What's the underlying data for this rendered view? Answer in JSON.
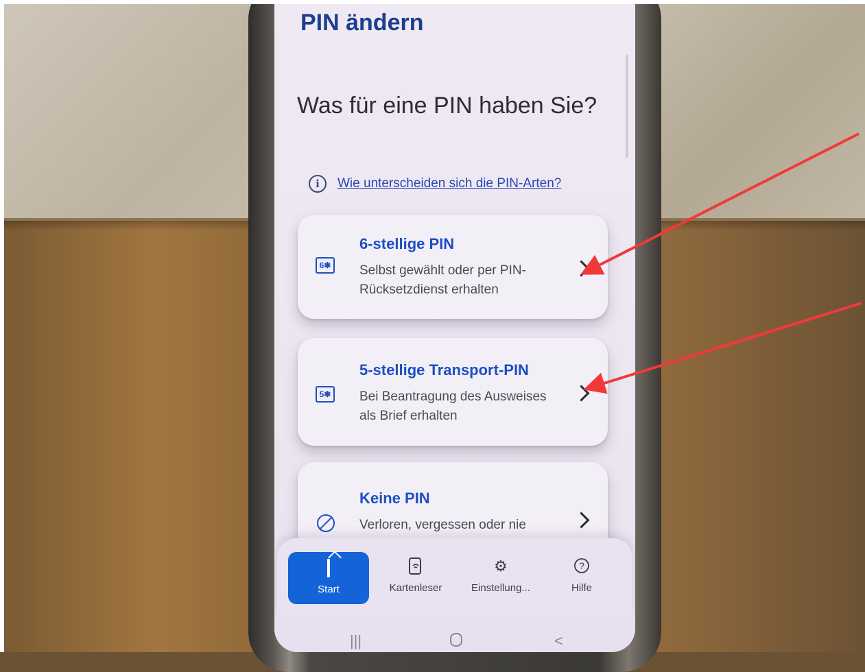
{
  "screen": {
    "page_title": "PIN ändern",
    "question": "Was für eine PIN haben Sie?",
    "info_link": "Wie unterscheiden sich die PIN-Arten?"
  },
  "cards": [
    {
      "icon_text": "6✱",
      "icon": "six-digit-pin-icon",
      "title": "6-stellige PIN",
      "description": "Selbst gewählt oder per PIN-Rücksetzdienst erhalten"
    },
    {
      "icon_text": "5✱",
      "icon": "five-digit-pin-icon",
      "title": "5-stellige Transport-PIN",
      "description": "Bei Beantragung des Ausweises als Brief erhalten"
    },
    {
      "icon": "no-pin-icon",
      "title": "Keine PIN",
      "description": "Verloren, vergessen oder nie"
    }
  ],
  "nav": {
    "items": [
      {
        "label": "Start",
        "icon": "home-icon",
        "active": true
      },
      {
        "label": "Kartenleser",
        "icon": "card-reader-icon"
      },
      {
        "label": "Einstellung...",
        "icon": "gear-icon"
      },
      {
        "label": "Hilfe",
        "icon": "help-icon"
      }
    ]
  },
  "system_bar": {
    "buttons": [
      "recent-apps-icon",
      "home-circle-icon",
      "back-icon"
    ]
  },
  "colors": {
    "accent": "#1d4fc4",
    "active_tab": "#1463d8",
    "annotation_arrow": "#f03a3a"
  }
}
